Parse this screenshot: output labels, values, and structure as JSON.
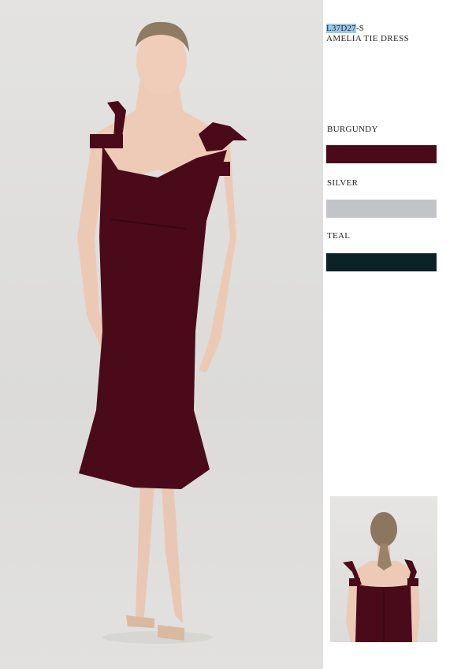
{
  "product": {
    "sku_highlighted": "L37D27",
    "sku_suffix": "-S",
    "name": "AMELIA TIE  DRESS"
  },
  "colors": [
    {
      "label": "BURGUNDY",
      "hex": "#4a0a1a"
    },
    {
      "label": "SILVER",
      "hex": "#c3c4c8"
    },
    {
      "label": "TEAL",
      "hex": "#0b2226"
    }
  ],
  "images": {
    "main": "model-front-photo",
    "back": "model-back-photo"
  }
}
